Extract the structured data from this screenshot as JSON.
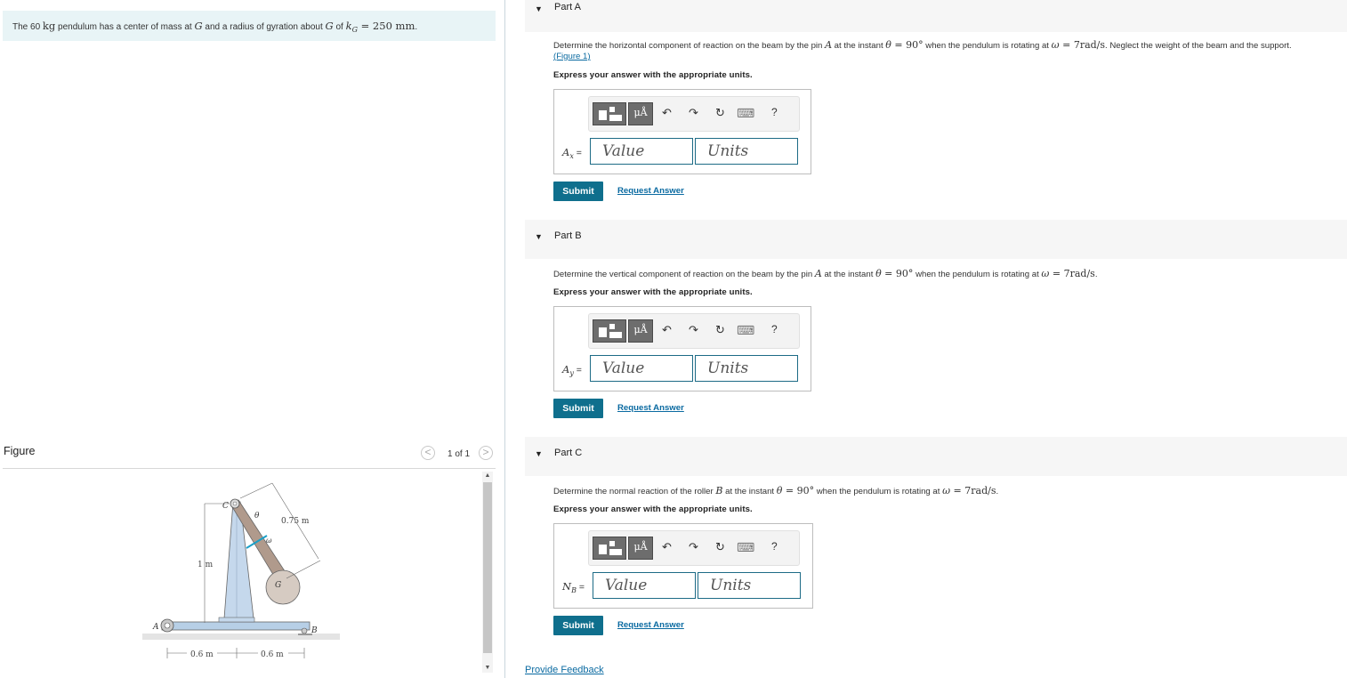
{
  "problem": {
    "t1": "The 60 ",
    "m1": "kg",
    "t2": " pendulum has a center of mass at ",
    "m2": "G",
    "t3": " and a radius of gyration about ",
    "m3": "G",
    "t4": " of ",
    "m4": "k",
    "m4sub": "G",
    "m5": " = 250 mm",
    "t5": "."
  },
  "figure": {
    "title": "Figure",
    "count": "1 of 1",
    "prev": "<",
    "next": ">",
    "labels": {
      "C": "C",
      "theta": "θ",
      "omega": "ω",
      "len": "0.75 m",
      "onem": "1 m",
      "G": "G",
      "A": "A",
      "B": "B",
      "d1": "0.6 m",
      "d2": "0.6 m"
    }
  },
  "toolbar": {
    "mu": "μÅ",
    "undo": "↶",
    "redo": "↷",
    "reset": "↻",
    "keyboard": "⌨",
    "help": "?"
  },
  "parts": [
    {
      "label": "Part A",
      "q1": "Determine the horizontal component of reaction on the beam by the pin ",
      "qA": "A",
      "q2": " at the instant ",
      "qTheta": "θ",
      "qEq1": " = 90°",
      "q3": " when the pendulum is rotating at ",
      "qOmega": "ω",
      "qEq2": " = 7rad/s",
      "q4": ". Neglect the weight of the beam and the support.",
      "figure_link": "(Figure 1)",
      "instruction": "Express your answer with the appropriate units.",
      "ans_symbol": "A",
      "ans_sub": "x",
      "ans_eq": " =",
      "value_placeholder": "Value",
      "units_placeholder": "Units",
      "submit": "Submit",
      "request": "Request Answer"
    },
    {
      "label": "Part B",
      "q1": "Determine the vertical component of reaction on the beam by the pin ",
      "qA": "A",
      "q2": " at the instant ",
      "qTheta": "θ",
      "qEq1": " = 90°",
      "q3": " when the pendulum is rotating at ",
      "qOmega": "ω",
      "qEq2": " = 7rad/s",
      "q4": ".",
      "instruction": "Express your answer with the appropriate units.",
      "ans_symbol": "A",
      "ans_sub": "y",
      "ans_eq": " =",
      "value_placeholder": "Value",
      "units_placeholder": "Units",
      "submit": "Submit",
      "request": "Request Answer"
    },
    {
      "label": "Part C",
      "q1": "Determine the normal reaction of the roller ",
      "qA": "B",
      "q2": " at the instant ",
      "qTheta": "θ",
      "qEq1": " = 90°",
      "q3": " when the pendulum is rotating at ",
      "qOmega": "ω",
      "qEq2": " = 7rad/s",
      "q4": ".",
      "instruction": "Express your answer with the appropriate units.",
      "ans_symbol": "N",
      "ans_sub": "B",
      "ans_eq": " =",
      "value_placeholder": "Value",
      "units_placeholder": "Units",
      "submit": "Submit",
      "request": "Request Answer"
    }
  ],
  "feedback": "Provide Feedback"
}
